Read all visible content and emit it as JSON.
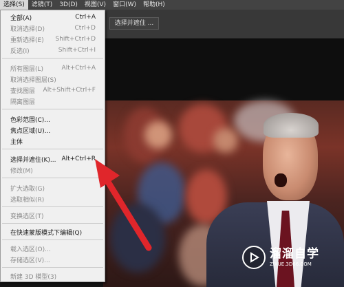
{
  "menubar": {
    "items": [
      {
        "label": "选择(S)"
      },
      {
        "label": "滤镜(T)"
      },
      {
        "label": "3D(D)"
      },
      {
        "label": "视图(V)"
      },
      {
        "label": "窗口(W)"
      },
      {
        "label": "帮助(H)"
      }
    ]
  },
  "optionsbar": {
    "select_mask_label": "选择并遮住 ..."
  },
  "dropdown": {
    "groups": [
      [
        {
          "label": "全部(A)",
          "shortcut": "Ctrl+A",
          "enabled": true
        },
        {
          "label": "取消选择(D)",
          "shortcut": "Ctrl+D",
          "enabled": false
        },
        {
          "label": "重新选择(E)",
          "shortcut": "Shift+Ctrl+D",
          "enabled": false
        },
        {
          "label": "反选(I)",
          "shortcut": "Shift+Ctrl+I",
          "enabled": false
        }
      ],
      [
        {
          "label": "所有图层(L)",
          "shortcut": "Alt+Ctrl+A",
          "enabled": false
        },
        {
          "label": "取消选择图层(S)",
          "shortcut": "",
          "enabled": false
        },
        {
          "label": "查找图层",
          "shortcut": "Alt+Shift+Ctrl+F",
          "enabled": false
        },
        {
          "label": "隔离图层",
          "shortcut": "",
          "enabled": false
        }
      ],
      [
        {
          "label": "色彩范围(C)...",
          "shortcut": "",
          "enabled": true
        },
        {
          "label": "焦点区域(U)...",
          "shortcut": "",
          "enabled": true
        },
        {
          "label": "主体",
          "shortcut": "",
          "enabled": true
        }
      ],
      [
        {
          "label": "选择并遮住(K)...",
          "shortcut": "Alt+Ctrl+R",
          "enabled": true
        },
        {
          "label": "修改(M)",
          "shortcut": "",
          "enabled": false
        }
      ],
      [
        {
          "label": "扩大选取(G)",
          "shortcut": "",
          "enabled": false
        },
        {
          "label": "选取相似(R)",
          "shortcut": "",
          "enabled": false
        }
      ],
      [
        {
          "label": "变换选区(T)",
          "shortcut": "",
          "enabled": false
        }
      ],
      [
        {
          "label": "在快速蒙版模式下编辑(Q)",
          "shortcut": "",
          "enabled": true
        }
      ],
      [
        {
          "label": "载入选区(O)...",
          "shortcut": "",
          "enabled": false
        },
        {
          "label": "存储选区(V)...",
          "shortcut": "",
          "enabled": false
        }
      ],
      [
        {
          "label": "新建 3D 模型(3)",
          "shortcut": "",
          "enabled": false
        }
      ]
    ]
  },
  "watermark": {
    "title": "溜溜自学",
    "url": "ZIXUE.3D66.COM"
  },
  "colors": {
    "annotation_arrow": "#e0262b",
    "menu_bg": "#f0f0f0",
    "menubar_bg": "#434343"
  }
}
